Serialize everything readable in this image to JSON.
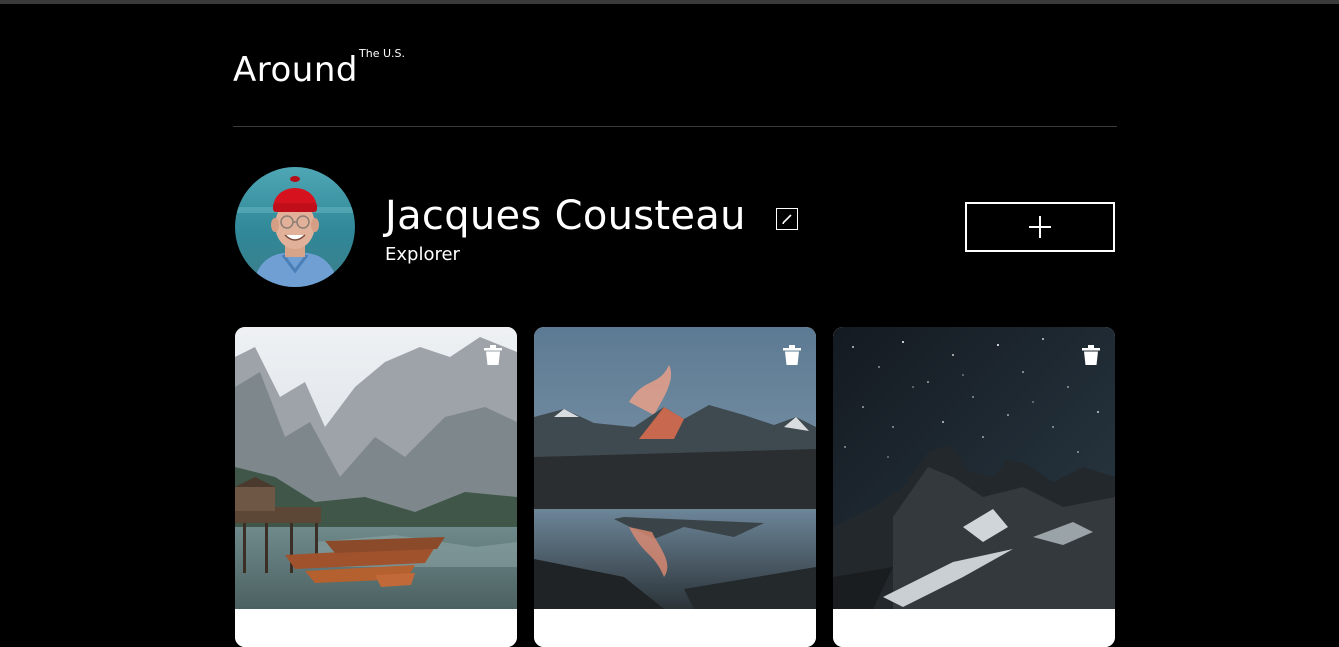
{
  "header": {
    "logo_main": "Around",
    "logo_sup": "The U.S."
  },
  "profile": {
    "name": "Jacques Cousteau",
    "about": "Explorer"
  },
  "icons": {
    "edit": "pencil-icon",
    "add": "plus-icon",
    "delete": "trash-icon"
  },
  "cards": [
    {
      "title": "",
      "image": "mountain-lake-with-boats"
    },
    {
      "title": "",
      "image": "mountain-reflection-dusk"
    },
    {
      "title": "",
      "image": "starry-night-mountains"
    }
  ],
  "colors": {
    "background": "#000000",
    "text": "#ffffff",
    "card": "#ffffff",
    "divider": "#3b3b3b"
  }
}
